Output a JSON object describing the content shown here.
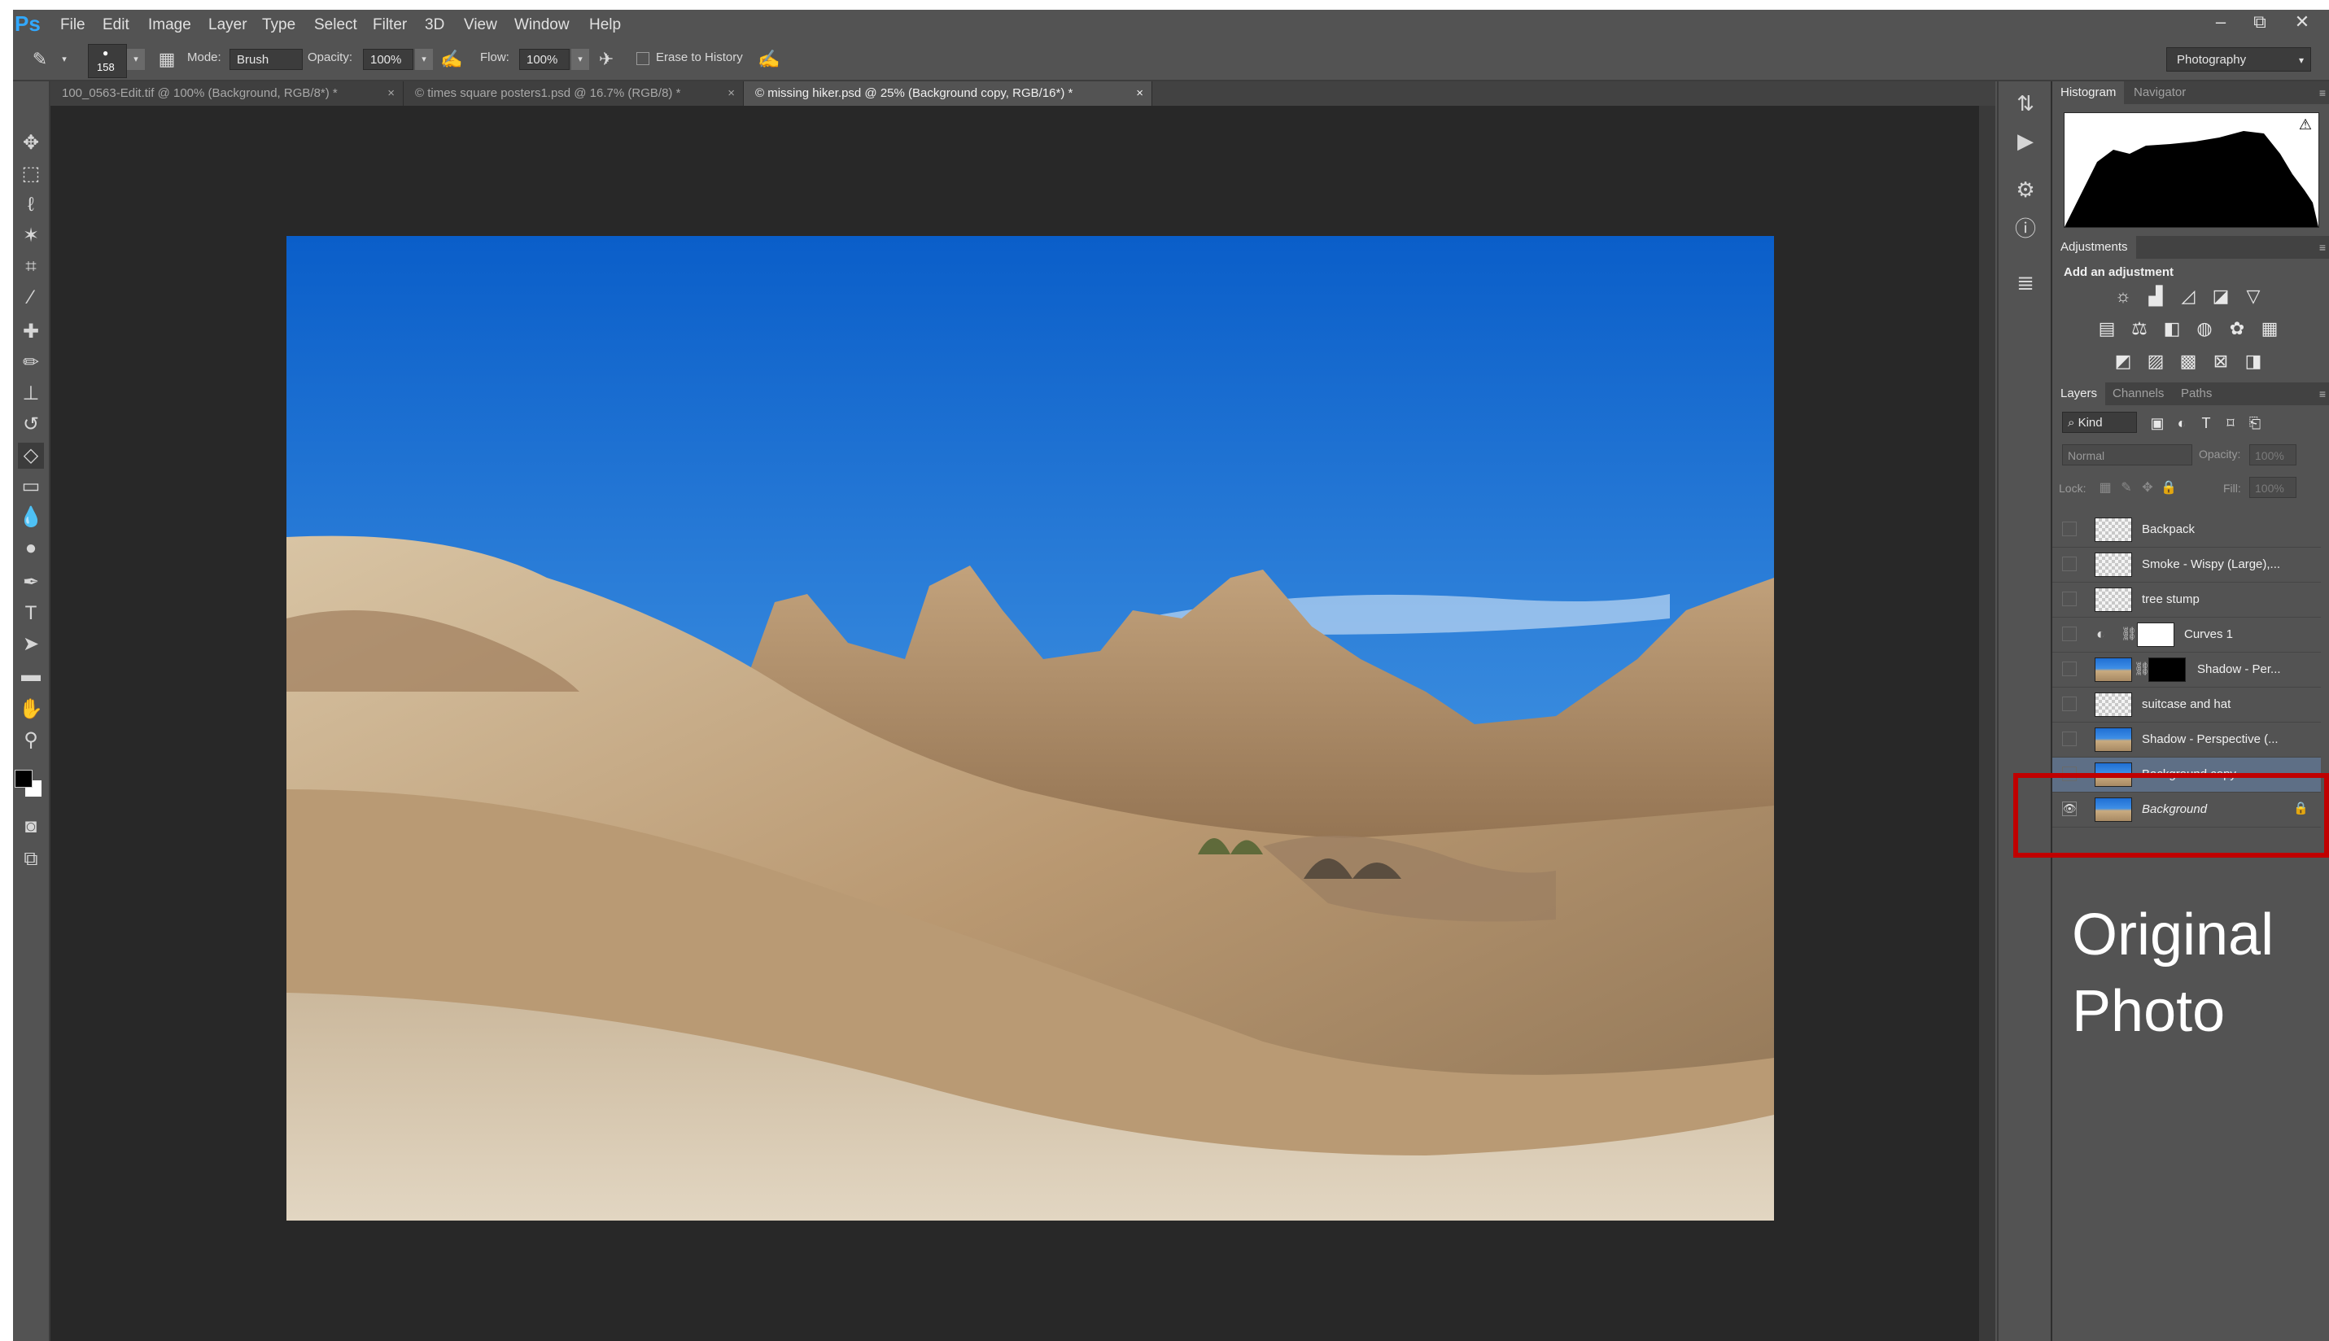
{
  "app": {
    "logo": "Ps"
  },
  "menubar": {
    "items": [
      "File",
      "Edit",
      "Image",
      "Layer",
      "Type",
      "Select",
      "Filter",
      "3D",
      "View",
      "Window",
      "Help"
    ]
  },
  "window_controls": {
    "minimize": "–",
    "restore": "⧉",
    "close": "✕"
  },
  "options_bar": {
    "brush_size": "158",
    "mode_label": "Mode:",
    "mode_value": "Brush",
    "opacity_label": "Opacity:",
    "opacity_value": "100%",
    "flow_label": "Flow:",
    "flow_value": "100%",
    "erase_to_history_label": "Erase to History",
    "erase_to_history_checked": false,
    "workspace": "Photography"
  },
  "document_tabs": [
    {
      "label": "100_0563-Edit.tif @ 100% (Background, RGB/8*) *",
      "close": "×",
      "active": false
    },
    {
      "label": "© times square posters1.psd @ 16.7% (RGB/8) *",
      "close": "×",
      "active": false
    },
    {
      "label": "© missing hiker.psd @ 25% (Background copy, RGB/16*) *",
      "close": "×",
      "active": true
    }
  ],
  "histogram_panel": {
    "tabs": [
      "Histogram",
      "Navigator"
    ],
    "warning_icon": "⚠"
  },
  "adjustments_panel": {
    "title": "Adjustments",
    "subtitle": "Add an adjustment"
  },
  "layers_panel": {
    "tabs": [
      "Layers",
      "Channels",
      "Paths"
    ],
    "filter_kind": "Kind",
    "blend_mode": "Normal",
    "opacity_label": "Opacity:",
    "opacity_value": "100%",
    "lock_label": "Lock:",
    "fill_label": "Fill:",
    "fill_value": "100%",
    "layers": [
      {
        "name": "Backpack",
        "visible": false
      },
      {
        "name": "Smoke - Wispy (Large),...",
        "visible": false
      },
      {
        "name": "tree stump",
        "visible": false
      },
      {
        "name": "Curves 1",
        "visible": false
      },
      {
        "name": "Shadow - Per...",
        "visible": false
      },
      {
        "name": "suitcase and hat",
        "visible": false
      },
      {
        "name": "Shadow - Perspective (...",
        "visible": false
      },
      {
        "name": "Background copy",
        "visible": false,
        "selected": true
      },
      {
        "name": "Background",
        "visible": true,
        "locked": true
      }
    ]
  },
  "annotation": {
    "line1": "Original",
    "line2": "Photo",
    "color": "#c00000"
  },
  "icons": [
    "eraser-tool-icon",
    "brush-preset-icon",
    "airbrush-icon",
    "pressure-icon",
    "move-tool-icon",
    "marquee-tool-icon",
    "lasso-tool-icon",
    "magic-wand-icon",
    "crop-tool-icon",
    "eyedropper-icon",
    "healing-brush-icon",
    "brush-tool-icon",
    "clone-stamp-icon",
    "history-brush-icon",
    "eraser-icon",
    "gradient-tool-icon",
    "blur-tool-icon",
    "dodge-tool-icon",
    "pen-tool-icon",
    "type-tool-icon",
    "path-select-icon",
    "shape-tool-icon",
    "hand-tool-icon",
    "zoom-tool-icon",
    "quick-mask-icon",
    "screen-mode-icon",
    "eye-icon",
    "lock-icon"
  ]
}
